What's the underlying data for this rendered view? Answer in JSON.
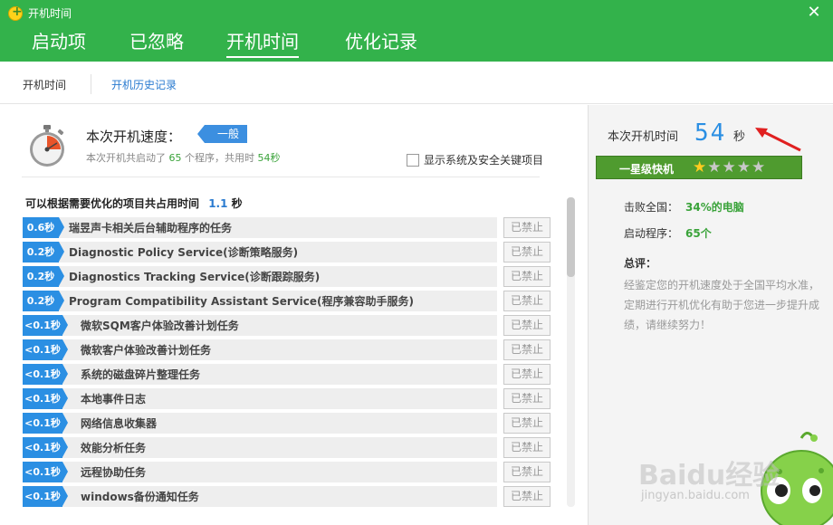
{
  "window": {
    "title": "开机时间",
    "close_symbol": "✕"
  },
  "tabs": [
    {
      "label": "启动项",
      "active": false
    },
    {
      "label": "已忽略",
      "active": false
    },
    {
      "label": "开机时间",
      "active": true
    },
    {
      "label": "优化记录",
      "active": false
    }
  ],
  "subnav": {
    "item1": "开机时间",
    "item2": "开机历史记录"
  },
  "speed": {
    "label": "本次开机速度：",
    "badge": "一般",
    "sub_prefix": "本次开机共启动了",
    "program_count": "65",
    "sub_middle": "个程序，共用时",
    "total_time": "54秒"
  },
  "show_system_label": "显示系统及安全关键项目",
  "optimize": {
    "label": "可以根据需要优化的项目共占用时间",
    "value": "1.1",
    "unit": "秒"
  },
  "rows": [
    {
      "time": "0.6秒",
      "name": "瑞昱声卡相关后台辅助程序的任务",
      "action": "已禁止"
    },
    {
      "time": "0.2秒",
      "name": "Diagnostic Policy Service(诊断策略服务)",
      "action": "已禁止"
    },
    {
      "time": "0.2秒",
      "name": "Diagnostics Tracking Service(诊断跟踪服务)",
      "action": "已禁止"
    },
    {
      "time": "0.2秒",
      "name": "Program Compatibility Assistant Service(程序兼容助手服务)",
      "action": "已禁止"
    },
    {
      "time": "<0.1秒",
      "name": "微软SQM客户体验改善计划任务",
      "action": "已禁止"
    },
    {
      "time": "<0.1秒",
      "name": "微软客户体验改善计划任务",
      "action": "已禁止"
    },
    {
      "time": "<0.1秒",
      "name": "系统的磁盘碎片整理任务",
      "action": "已禁止"
    },
    {
      "time": "<0.1秒",
      "name": "本地事件日志",
      "action": "已禁止"
    },
    {
      "time": "<0.1秒",
      "name": "网络信息收集器",
      "action": "已禁止"
    },
    {
      "time": "<0.1秒",
      "name": "效能分析任务",
      "action": "已禁止"
    },
    {
      "time": "<0.1秒",
      "name": "远程协助任务",
      "action": "已禁止"
    },
    {
      "time": "<0.1秒",
      "name": "windows备份通知任务",
      "action": "已禁止"
    }
  ],
  "right": {
    "boot_time_label": "本次开机时间",
    "boot_time_value": "54",
    "boot_time_unit": "秒",
    "rank_label": "一星级快机",
    "stars_filled": 1,
    "stars_total": 5,
    "beat_label": "击败全国：",
    "beat_value": "34%的电脑",
    "startup_label": "启动程序：",
    "startup_value": "65个",
    "summary_title": "总评：",
    "summary_text": "经鉴定您的开机速度处于全国平均水准，定期进行开机优化有助于您进一步提升成绩，请继续努力！"
  },
  "watermark": {
    "text": "Baidu经验",
    "url": "jingyan.baidu.com"
  },
  "colors": {
    "header_green": "#33b24b",
    "accent_blue": "#2b8fe3",
    "value_green": "#3aa33a",
    "ribbon_green": "#4f9b2f"
  }
}
